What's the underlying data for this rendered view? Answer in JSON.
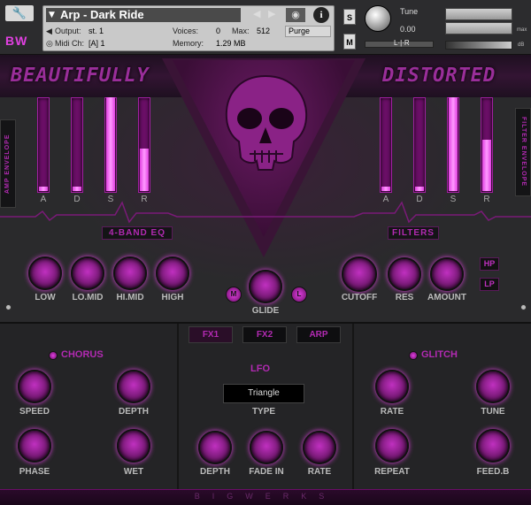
{
  "header": {
    "logo": "BW",
    "instrument_name": "Arp - Dark Ride",
    "output_label": "Output:",
    "output_value": "st. 1",
    "midi_label": "Midi Ch:",
    "midi_value": "[A]  1",
    "voices_label": "Voices:",
    "voices_value": "0",
    "max_label": "Max:",
    "max_value": "512",
    "memory_label": "Memory:",
    "memory_value": "1.29 MB",
    "purge_label": "Purge",
    "solo_label": "S",
    "mute_label": "M",
    "tune_label": "Tune",
    "tune_value": "0.00",
    "pan_value": "L·|·R",
    "max_meter_label": "max",
    "db_label": "dB"
  },
  "panel": {
    "title_left": "BEAUTIFULLY",
    "title_right": "DISTORTED",
    "amp_envelope_label": "AMP ENVELOPE",
    "filter_envelope_label": "FILTER ENVELOPE",
    "amp_env": [
      {
        "label": "A",
        "level": 0.05
      },
      {
        "label": "D",
        "level": 0.05
      },
      {
        "label": "S",
        "level": 1.0
      },
      {
        "label": "R",
        "level": 0.45
      }
    ],
    "filter_env": [
      {
        "label": "A",
        "level": 0.05
      },
      {
        "label": "D",
        "level": 0.05
      },
      {
        "label": "S",
        "level": 1.0
      },
      {
        "label": "R",
        "level": 0.55
      }
    ],
    "eq_label": "4-BAND EQ",
    "filters_label": "FILTERS",
    "eq_knobs": [
      "LOW",
      "LO.MID",
      "HI.MID",
      "HIGH"
    ],
    "glide_label": "GLIDE",
    "glide_left": "M",
    "glide_right": "L",
    "filter_knobs": [
      "CUTOFF",
      "RES",
      "AMOUNT"
    ],
    "hp_label": "HP",
    "lp_label": "LP"
  },
  "tabs": [
    "FX1",
    "FX2",
    "ARP"
  ],
  "chorus": {
    "title": "CHORUS",
    "knobs": [
      "SPEED",
      "DEPTH",
      "PHASE",
      "WET"
    ]
  },
  "lfo": {
    "title": "LFO",
    "type_value": "Triangle",
    "type_label": "TYPE",
    "knobs": [
      "DEPTH",
      "FADE IN",
      "RATE"
    ]
  },
  "glitch": {
    "title": "GLITCH",
    "knobs": [
      "RATE",
      "TUNE",
      "REPEAT",
      "FEED.B"
    ]
  },
  "footer": "BIGWERKS"
}
